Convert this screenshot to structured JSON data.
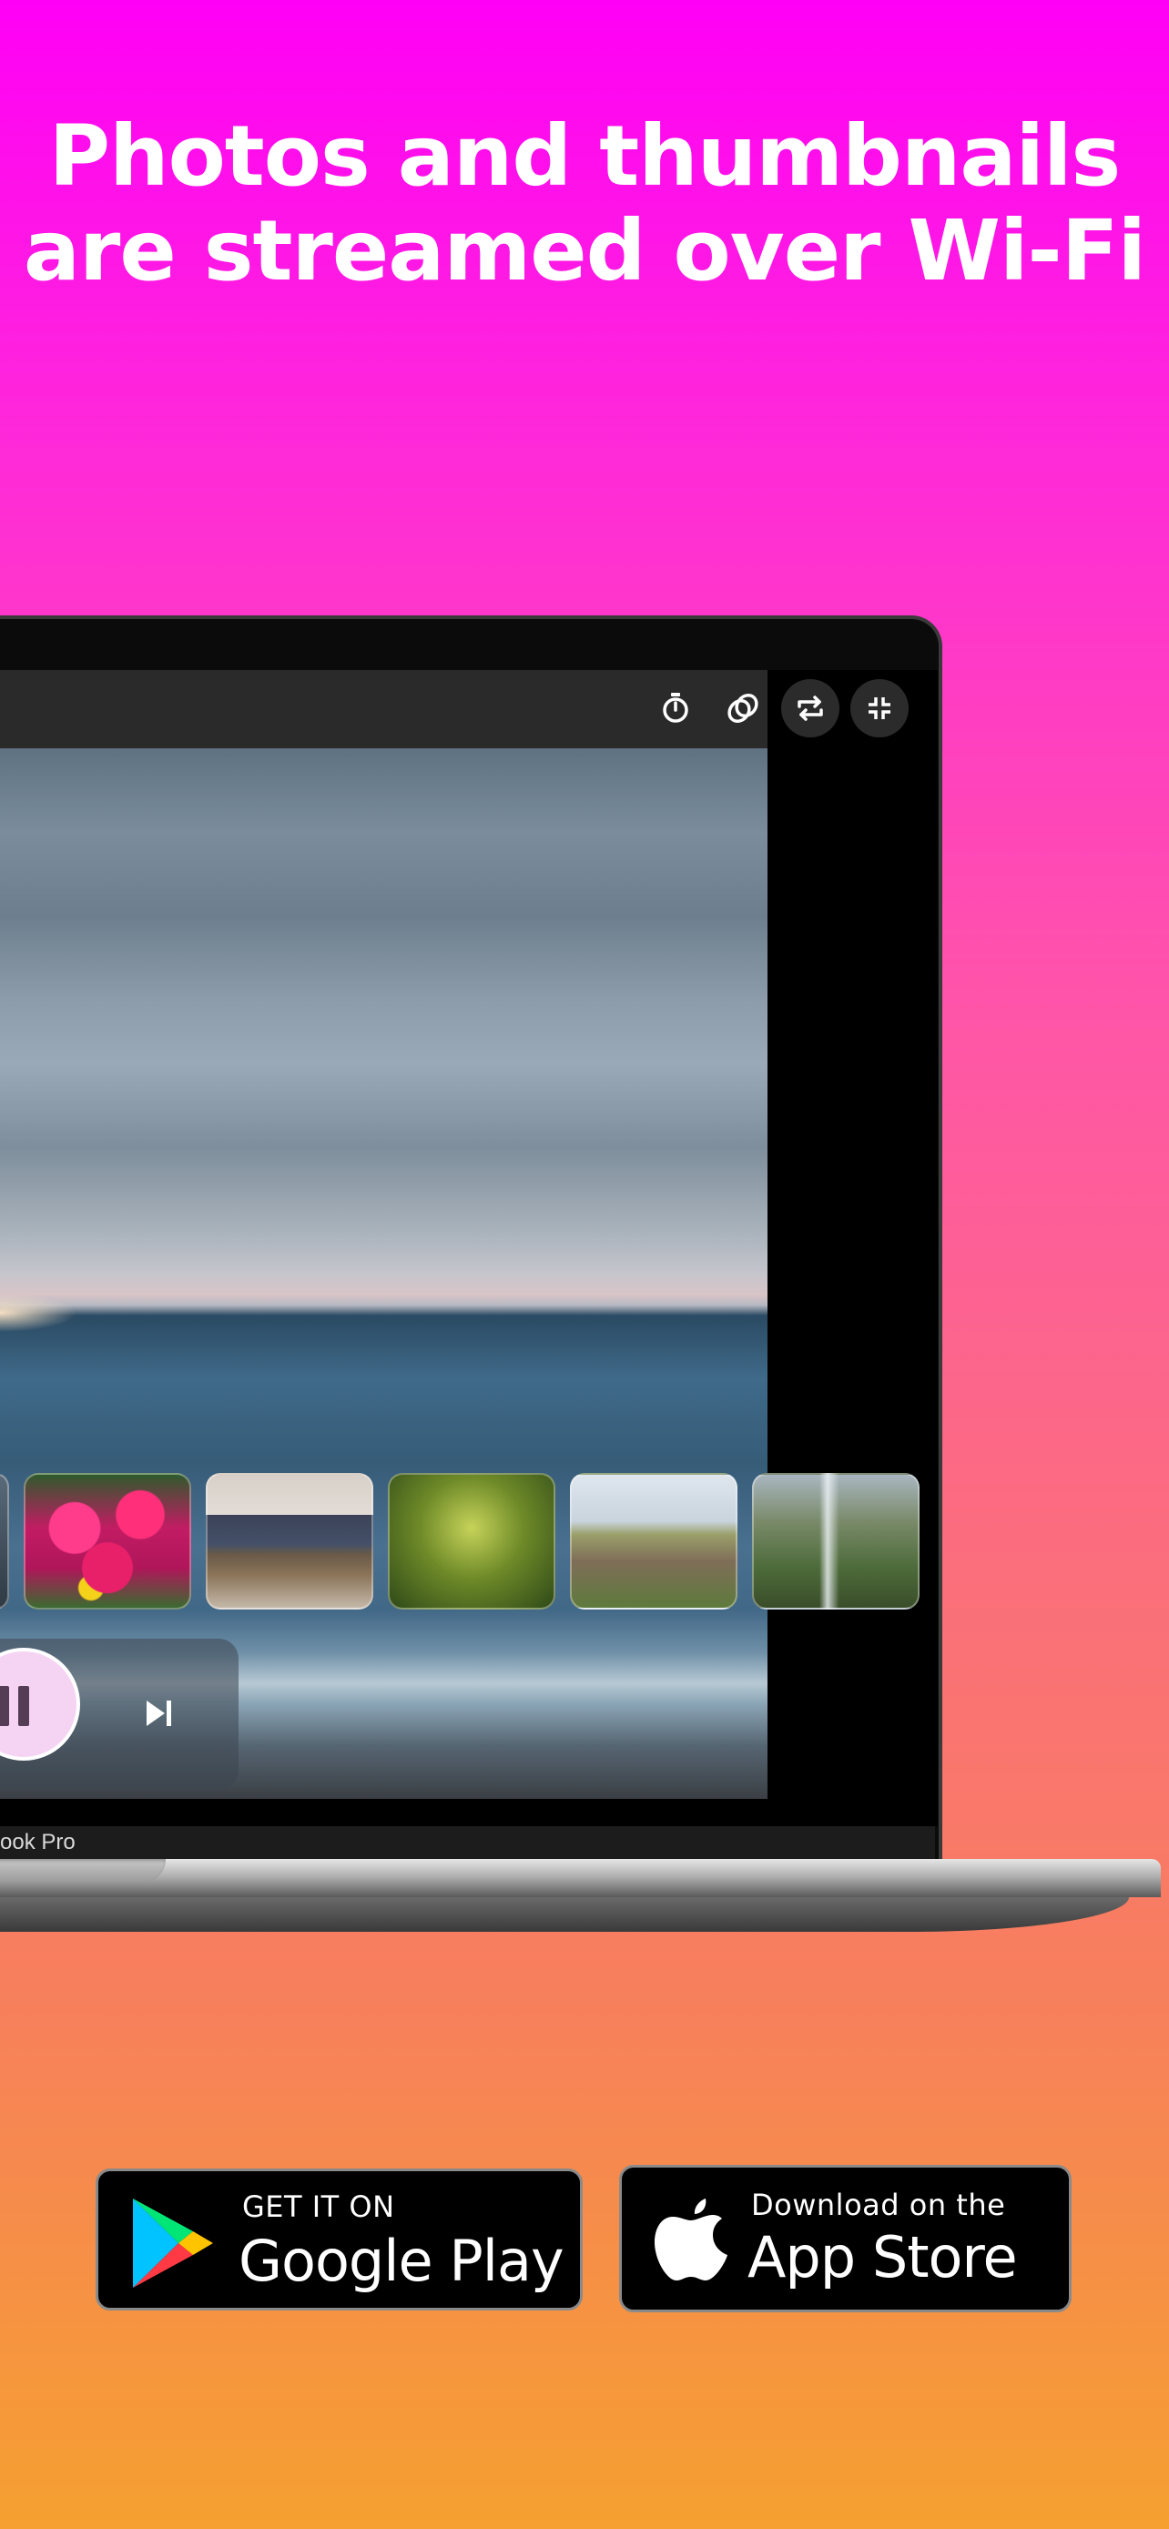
{
  "headline": {
    "line1": "Photos and thumbnails",
    "line2": "are streamed over Wi-Fi"
  },
  "viewer": {
    "toolbar_icons": [
      "timer-icon",
      "layers-icon",
      "repeat-icon",
      "exit-fullscreen-icon"
    ],
    "thumbnails": [
      "thumbnail-partial",
      "thumbnail-flowers",
      "thumbnail-desk",
      "thumbnail-leaves",
      "thumbnail-coast",
      "thumbnail-waterfall"
    ],
    "controls": {
      "pause_icon": "pause-icon",
      "next_icon": "skip-next-icon"
    },
    "device_label": "ook Pro"
  },
  "badges": {
    "google_play": {
      "small": "GET IT ON",
      "big": "Google Play"
    },
    "app_store": {
      "small": "Download on the",
      "big": "App Store"
    }
  },
  "colors": {
    "gradient_top": "#ff00f6",
    "gradient_bottom": "#f5a030",
    "pause_button": "#f5d4f3"
  }
}
